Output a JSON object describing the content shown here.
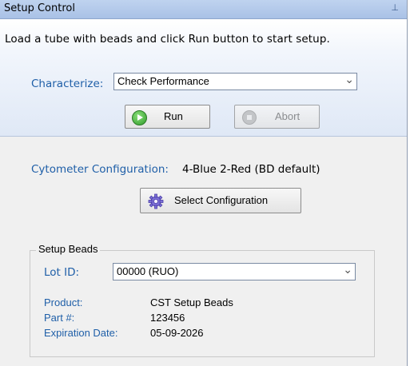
{
  "window": {
    "title": "Setup Control",
    "pin_icon": "pin-icon"
  },
  "setup": {
    "instruction": "Load a tube with beads and click Run button to start setup.",
    "characterize_label": "Characterize:",
    "characterize_value": "Check Performance",
    "run_label": "Run",
    "abort_label": "Abort"
  },
  "configuration": {
    "label": "Cytometer Configuration:",
    "value": "4-Blue 2-Red (BD default)",
    "select_button_label": "Select Configuration"
  },
  "setup_beads": {
    "group_title": "Setup Beads",
    "lot_id_label": "Lot ID:",
    "lot_id_value": "00000 (RUO)",
    "product_label": "Product:",
    "product_value": "CST Setup Beads",
    "part_label": "Part #:",
    "part_value": "123456",
    "expiration_label": "Expiration Date:",
    "expiration_value": "05-09-2026"
  },
  "colors": {
    "label_blue": "#1f5fa8",
    "title_bar": "#bfd3ef",
    "run_icon_green": "#2f9b2a"
  }
}
